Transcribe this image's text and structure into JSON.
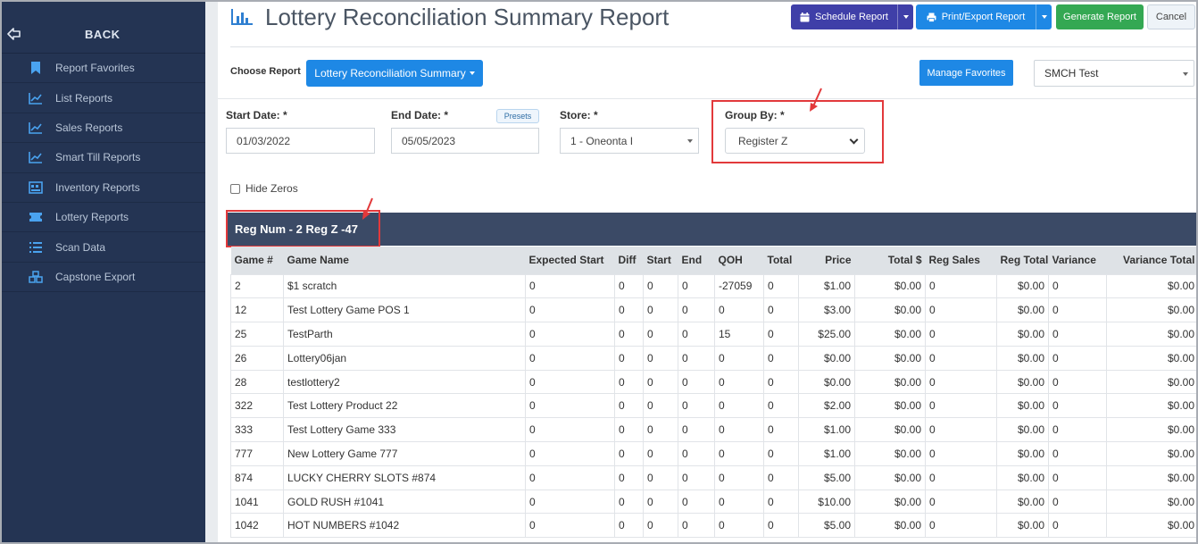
{
  "sidebar": {
    "back_label": "BACK",
    "items": [
      {
        "label": "Report Favorites",
        "icon": "bookmark-icon"
      },
      {
        "label": "List Reports",
        "icon": "line-chart-icon"
      },
      {
        "label": "Sales Reports",
        "icon": "line-chart-icon"
      },
      {
        "label": "Smart Till Reports",
        "icon": "line-chart-icon"
      },
      {
        "label": "Inventory Reports",
        "icon": "inventory-icon"
      },
      {
        "label": "Lottery Reports",
        "icon": "ticket-icon"
      },
      {
        "label": "Scan Data",
        "icon": "list-icon"
      },
      {
        "label": "Capstone Export",
        "icon": "boxes-icon"
      }
    ]
  },
  "header": {
    "title": "Lottery Reconciliation Summary Report",
    "schedule_label": "Schedule Report",
    "print_label": "Print/Export Report",
    "generate_label": "Generate Report",
    "cancel_label": "Cancel"
  },
  "toolbar": {
    "choose_label": "Choose Report",
    "report_value": "Lottery Reconciliation Summary",
    "manage_label": "Manage Favorites",
    "store_group_value": "SMCH Test"
  },
  "filters": {
    "start_label": "Start Date: *",
    "start_value": "01/03/2022",
    "end_label": "End Date: *",
    "end_value": "05/05/2023",
    "presets_label": "Presets",
    "store_label": "Store: *",
    "store_value": "1 - Oneonta I",
    "group_label": "Group By: *",
    "group_value": "Register Z",
    "hide_zeros_label": "Hide Zeros"
  },
  "group": {
    "title": "Reg Num - 2 Reg Z -47"
  },
  "table": {
    "headers": [
      "Game #",
      "Game Name",
      "Expected Start",
      "Diff",
      "Start",
      "End",
      "QOH",
      "Total",
      "Price",
      "Total $",
      "Reg Sales",
      "Reg Total",
      "Variance",
      "Variance Total"
    ],
    "rows": [
      [
        "2",
        "$1 scratch",
        "0",
        "0",
        "0",
        "0",
        "-27059",
        "0",
        "$1.00",
        "$0.00",
        "0",
        "$0.00",
        "0",
        "$0.00"
      ],
      [
        "12",
        "Test Lottery Game POS 1",
        "0",
        "0",
        "0",
        "0",
        "0",
        "0",
        "$3.00",
        "$0.00",
        "0",
        "$0.00",
        "0",
        "$0.00"
      ],
      [
        "25",
        "TestParth",
        "0",
        "0",
        "0",
        "0",
        "15",
        "0",
        "$25.00",
        "$0.00",
        "0",
        "$0.00",
        "0",
        "$0.00"
      ],
      [
        "26",
        "Lottery06jan",
        "0",
        "0",
        "0",
        "0",
        "0",
        "0",
        "$0.00",
        "$0.00",
        "0",
        "$0.00",
        "0",
        "$0.00"
      ],
      [
        "28",
        "testlottery2",
        "0",
        "0",
        "0",
        "0",
        "0",
        "0",
        "$0.00",
        "$0.00",
        "0",
        "$0.00",
        "0",
        "$0.00"
      ],
      [
        "322",
        "Test Lottery Product 22",
        "0",
        "0",
        "0",
        "0",
        "0",
        "0",
        "$2.00",
        "$0.00",
        "0",
        "$0.00",
        "0",
        "$0.00"
      ],
      [
        "333",
        "Test Lottery Game 333",
        "0",
        "0",
        "0",
        "0",
        "0",
        "0",
        "$1.00",
        "$0.00",
        "0",
        "$0.00",
        "0",
        "$0.00"
      ],
      [
        "777",
        "New Lottery Game 777",
        "0",
        "0",
        "0",
        "0",
        "0",
        "0",
        "$1.00",
        "$0.00",
        "0",
        "$0.00",
        "0",
        "$0.00"
      ],
      [
        "874",
        "LUCKY CHERRY SLOTS #874",
        "0",
        "0",
        "0",
        "0",
        "0",
        "0",
        "$5.00",
        "$0.00",
        "0",
        "$0.00",
        "0",
        "$0.00"
      ],
      [
        "1041",
        "GOLD RUSH #1041",
        "0",
        "0",
        "0",
        "0",
        "0",
        "0",
        "$10.00",
        "$0.00",
        "0",
        "$0.00",
        "0",
        "$0.00"
      ],
      [
        "1042",
        "HOT NUMBERS #1042",
        "0",
        "0",
        "0",
        "0",
        "0",
        "0",
        "$5.00",
        "$0.00",
        "0",
        "$0.00",
        "0",
        "$0.00"
      ]
    ]
  },
  "colors": {
    "sidebar_bg": "#243453",
    "accent_blue": "#1e88e5",
    "schedule_btn": "#3f3fa8",
    "generate_btn": "#34a853",
    "annotation_red": "#e2393b",
    "group_header_bg": "#3b4a66"
  }
}
